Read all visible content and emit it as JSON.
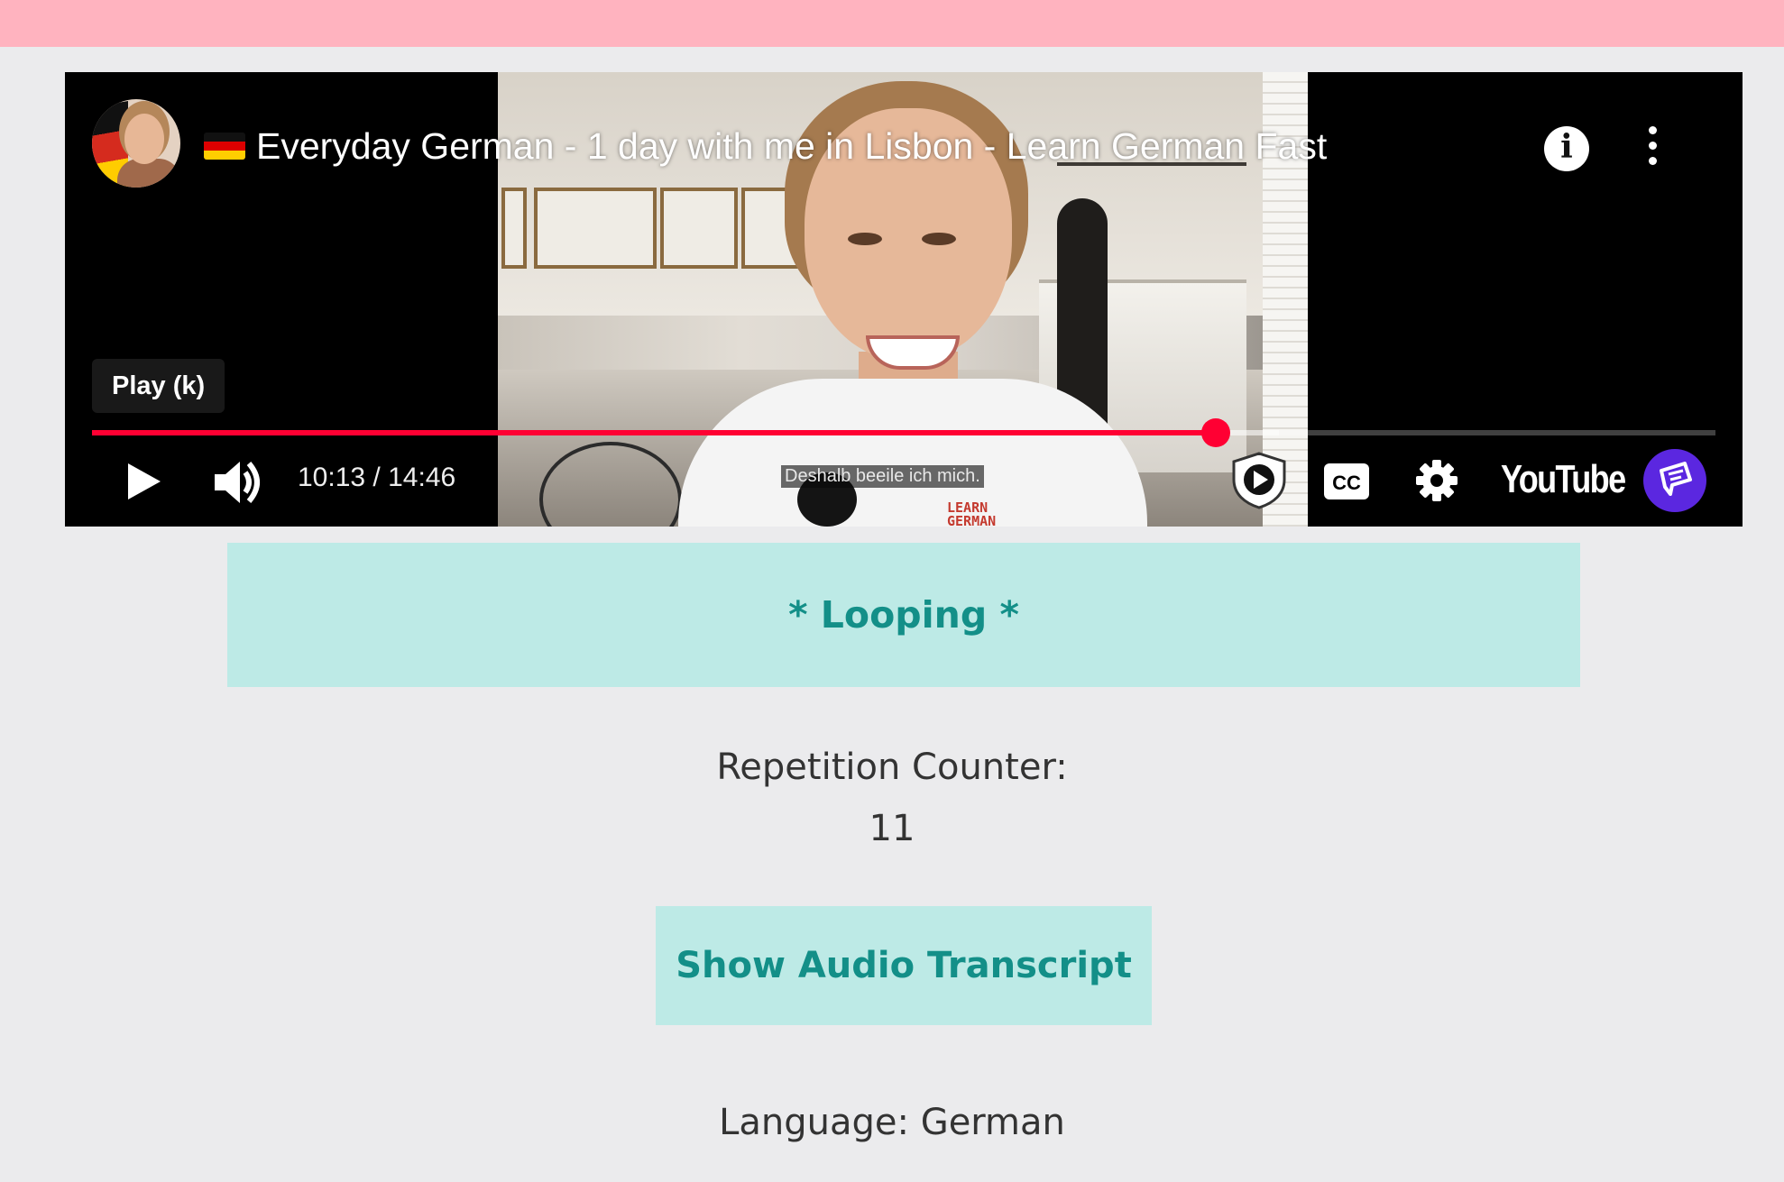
{
  "player": {
    "title": "Everyday German - 1 day with me in Lisbon - Learn German Fast",
    "tooltip": "Play (k)",
    "current_time": "10:13",
    "duration": "14:46",
    "time_display": "10:13 / 14:46",
    "progress_fraction": 0.692,
    "buffered_fraction": 0.731,
    "subtitle": "Deshalb beeile ich mich.",
    "shirt_logo": "LEARN GERMAN",
    "brand": "YouTube",
    "colors": {
      "progress": "#ff0033",
      "extension": "#5b27e0"
    },
    "icons": [
      "channel-avatar",
      "germany-flag-icon",
      "info-icon",
      "more-vert-icon",
      "play-icon",
      "volume-icon",
      "shield-play-icon",
      "cc-icon",
      "gear-icon",
      "youtube-logo",
      "extension-icon"
    ]
  },
  "looping_label": "* Looping *",
  "repetition": {
    "label": "Repetition Counter:",
    "value": "11"
  },
  "transcript_button": "Show Audio Transcript",
  "language": "Language: German",
  "colors": {
    "top_bar": "#ffb3bf",
    "accent_bg": "#bdeae6",
    "accent_text": "#138f88",
    "page_bg": "#ebebed"
  }
}
